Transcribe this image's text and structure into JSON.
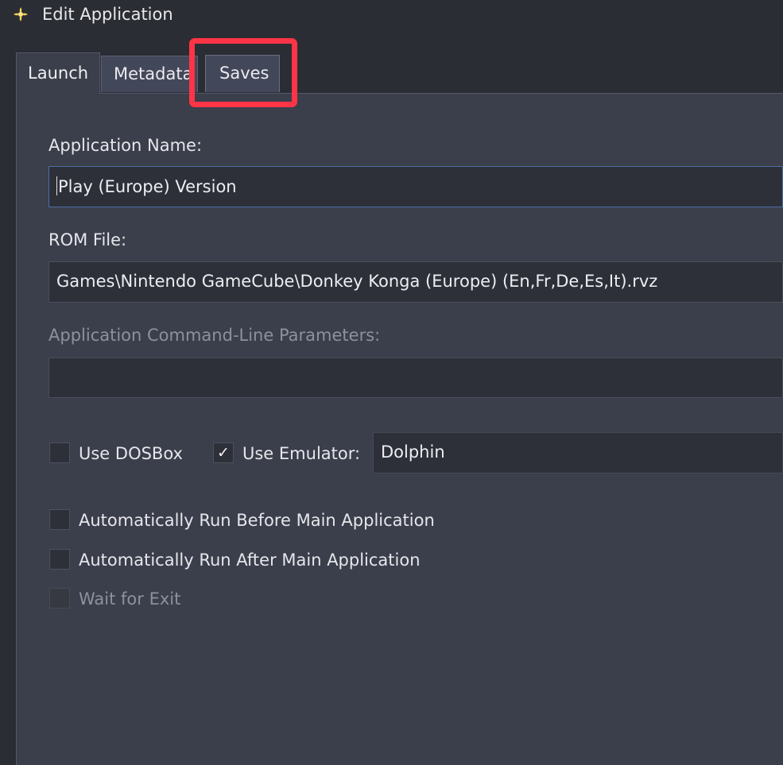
{
  "window": {
    "title": "Edit Application"
  },
  "tabs": [
    {
      "label": "Launch",
      "active": true
    },
    {
      "label": "Metadata",
      "active": false
    },
    {
      "label": "Saves",
      "active": false,
      "highlighted": true
    }
  ],
  "form": {
    "app_name": {
      "label": "Application Name:",
      "value": "Play (Europe) Version"
    },
    "rom_file": {
      "label": "ROM File:",
      "value": "Games\\Nintendo GameCube\\Donkey Konga (Europe) (En,Fr,De,Es,It).rvz"
    },
    "cmd_params": {
      "label": "Application Command-Line Parameters:",
      "value": ""
    },
    "use_dosbox": {
      "label": "Use DOSBox",
      "checked": false
    },
    "use_emulator": {
      "label": "Use Emulator:",
      "checked": true,
      "check_glyph": "✓"
    },
    "emulator": {
      "value": "Dolphin"
    },
    "run_before": {
      "label": "Automatically Run Before Main Application",
      "checked": false
    },
    "run_after": {
      "label": "Automatically Run After Main Application",
      "checked": false
    },
    "wait_exit": {
      "label": "Wait for Exit",
      "checked": false,
      "disabled": true
    }
  },
  "colors": {
    "highlight": "#ff3446",
    "panel": "#3b3e4b",
    "field": "#2e3039",
    "focus_border": "#4a6fa5"
  }
}
